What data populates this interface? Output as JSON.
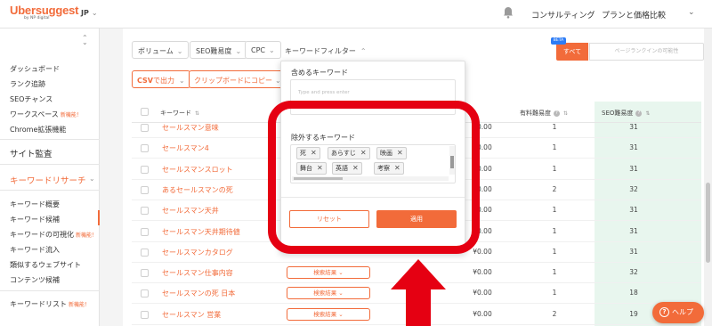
{
  "header": {
    "logo_text": "Ubersuggest",
    "logo_sub": "by NP digital",
    "lang": "JP",
    "consulting": "コンサルティング",
    "plans": "プランと価格比較"
  },
  "sidebar": {
    "items": [
      {
        "label": "ダッシュボード",
        "new": ""
      },
      {
        "label": "ランク追跡",
        "new": ""
      },
      {
        "label": "SEOチャンス",
        "new": ""
      },
      {
        "label": "ワークスペース",
        "new": "新機能！"
      },
      {
        "label": "Chrome拡張機能",
        "new": ""
      }
    ],
    "site_audit": "サイト監査",
    "keyword_research": "キーワードリサーチ",
    "kr_items": [
      {
        "label": "キーワード概要",
        "new": ""
      },
      {
        "label": "キーワード候補",
        "new": ""
      },
      {
        "label": "キーワードの可視化",
        "new": "新機能！"
      },
      {
        "label": "キーワード流入",
        "new": ""
      },
      {
        "label": "類似するウェブサイト",
        "new": ""
      },
      {
        "label": "コンテンツ候補",
        "new": ""
      }
    ],
    "keyword_list": "キーワードリスト",
    "keyword_list_new": "新機能！"
  },
  "filters": {
    "volume": "ボリューム",
    "seo_difficulty": "SEO難易度",
    "cpc": "CPC",
    "keyword_filter": "キーワードフィルター",
    "csv_prefix": "CSV",
    "csv_rest": "で出力",
    "clipboard": "クリップボードにコピー"
  },
  "toggle": {
    "beta": "BETA",
    "all": "すべて",
    "other": "ページランクインの可能性"
  },
  "table": {
    "col_keyword": "キーワード",
    "col_paid": "有料難易度",
    "col_seo": "SEO難易度",
    "result_label": "検索結果",
    "rows": [
      {
        "kw": "セールスマン意味",
        "btn": false,
        "cpc": "¥0.00",
        "paid": "1",
        "seo": "31"
      },
      {
        "kw": "セールスマン4",
        "btn": false,
        "cpc": "¥0.00",
        "paid": "1",
        "seo": "31"
      },
      {
        "kw": "セールスマンスロット",
        "btn": false,
        "cpc": "¥0.00",
        "paid": "1",
        "seo": "31"
      },
      {
        "kw": "あるセールスマンの死",
        "btn": false,
        "cpc": "¥0.00",
        "paid": "2",
        "seo": "32"
      },
      {
        "kw": "セールスマン天井",
        "btn": false,
        "cpc": "¥0.00",
        "paid": "1",
        "seo": "31"
      },
      {
        "kw": "セールスマン天井期待値",
        "btn": false,
        "cpc": "¥0.00",
        "paid": "1",
        "seo": "31"
      },
      {
        "kw": "セールスマンカタログ",
        "btn": false,
        "cpc": "¥0.00",
        "paid": "1",
        "seo": "31"
      },
      {
        "kw": "セールスマン仕事内容",
        "btn": true,
        "cpc": "¥0.00",
        "paid": "1",
        "seo": "32"
      },
      {
        "kw": "セールスマンの死 日本",
        "btn": true,
        "cpc": "¥0.00",
        "paid": "1",
        "seo": "18"
      },
      {
        "kw": "セールスマン 営業",
        "btn": true,
        "cpc": "¥0.00",
        "paid": "2",
        "seo": "19"
      }
    ]
  },
  "popup": {
    "include_label": "含めるキーワード",
    "include_placeholder": "Type and press enter",
    "exclude_label": "除外するキーワード",
    "tags": [
      "死",
      "あらすじ",
      "映画",
      "舞台",
      "英語",
      "考察"
    ],
    "reset": "リセット",
    "apply": "適用"
  },
  "help": {
    "label": "ヘルプ"
  },
  "colors": {
    "accent": "#f26b3a",
    "annotation": "#e50012",
    "seo_col_bg": "#e8f6ee"
  }
}
